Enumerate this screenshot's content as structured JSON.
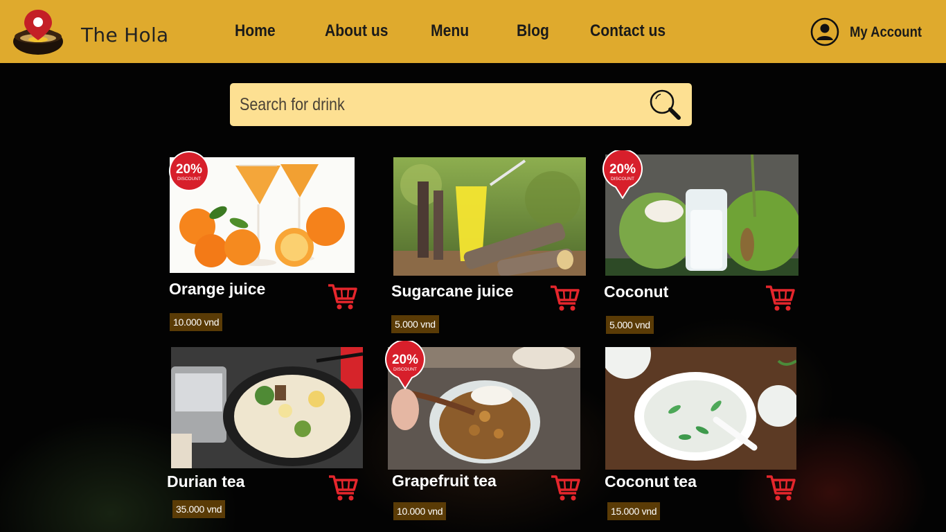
{
  "header": {
    "brand": "The Hola",
    "nav": [
      "Home",
      "About us",
      "Menu",
      "Blog",
      "Contact us"
    ],
    "account_label": "My Account"
  },
  "search": {
    "placeholder": "Search for drink"
  },
  "badge": {
    "percent": "20%",
    "word": "DISCOUNT"
  },
  "products": [
    {
      "name": "Orange juice",
      "price": "10.000 vnd",
      "discount": true
    },
    {
      "name": "Sugarcane juice",
      "price": "5.000 vnd",
      "discount": false
    },
    {
      "name": "Coconut",
      "price": "5.000 vnd",
      "discount": true
    },
    {
      "name": "Durian tea",
      "price": "35.000 vnd",
      "discount": false
    },
    {
      "name": "Grapefruit tea",
      "price": "10.000 vnd",
      "discount": true
    },
    {
      "name": "Coconut tea",
      "price": "15.000 vnd",
      "discount": false
    }
  ],
  "colors": {
    "header": "#dfaa2d",
    "search_bg": "#fde092",
    "price_bg": "#5a3b06",
    "cart": "#e5262c",
    "badge": "#d71f2b"
  },
  "icons": {
    "logo": "map-pin-bowl-logo",
    "account": "user-circle-icon",
    "search": "magnifier-icon",
    "cart": "cart-icon"
  }
}
